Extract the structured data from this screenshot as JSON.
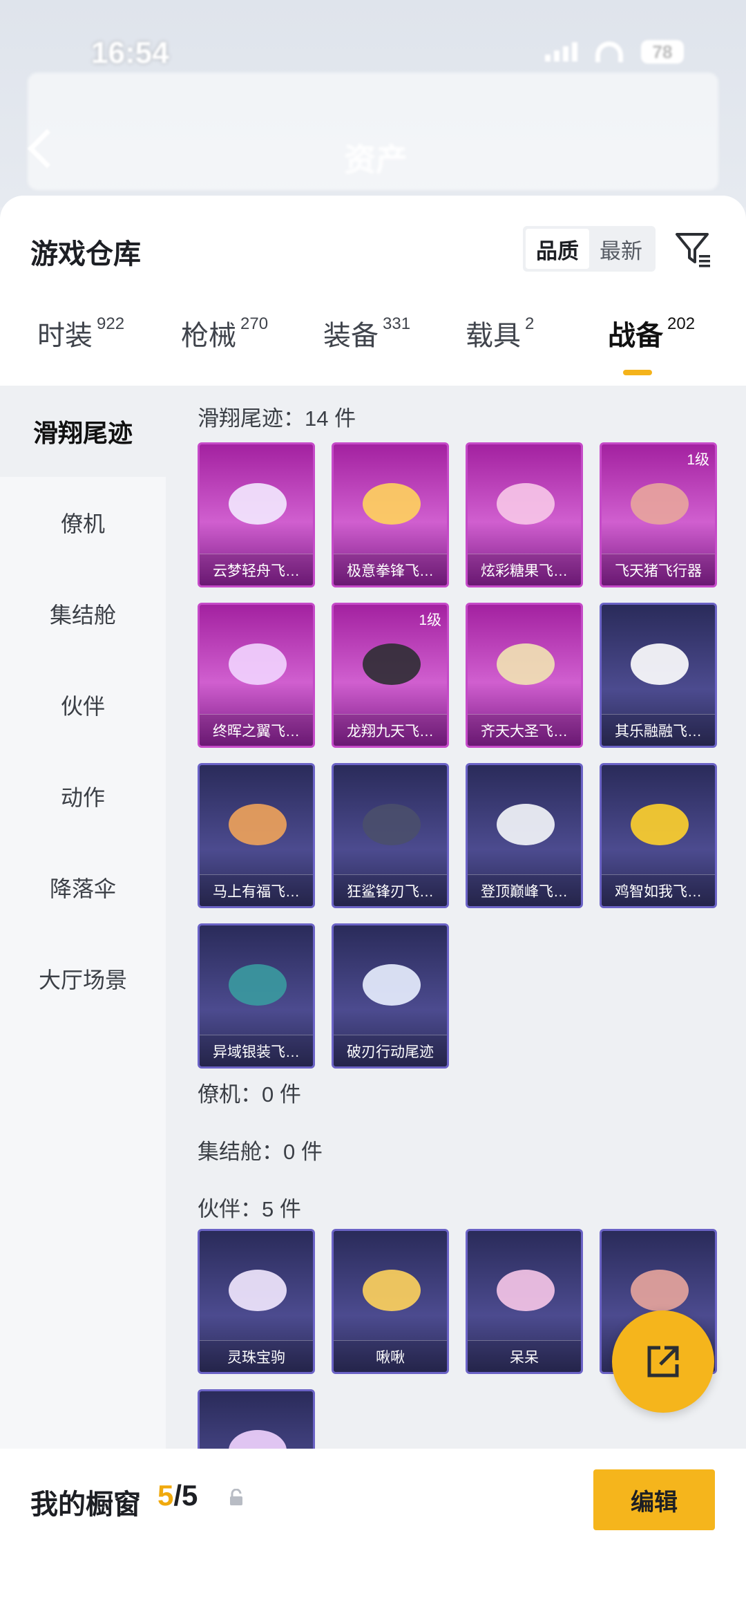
{
  "status": {
    "time": "16:54",
    "battery": "78"
  },
  "nav": {
    "title": "资产"
  },
  "sheet": {
    "title": "游戏仓库"
  },
  "sort": {
    "options": [
      "品质",
      "最新"
    ],
    "active": "品质"
  },
  "tabs": [
    {
      "label": "时装",
      "count": "922"
    },
    {
      "label": "枪械",
      "count": "270"
    },
    {
      "label": "装备",
      "count": "331"
    },
    {
      "label": "载具",
      "count": "2"
    },
    {
      "label": "战备",
      "count": "202"
    }
  ],
  "active_tab": "战备",
  "sidebar": {
    "items": [
      "滑翔尾迹",
      "僚机",
      "集结舱",
      "伙伴",
      "动作",
      "降落伞",
      "大厅场景"
    ],
    "active": "滑翔尾迹"
  },
  "sections": {
    "glide": {
      "title": "滑翔尾迹：14 件",
      "items": [
        {
          "name": "云梦轻舟飞…",
          "level": "",
          "rarity": "pink"
        },
        {
          "name": "极意拳锋飞…",
          "level": "",
          "rarity": "pink"
        },
        {
          "name": "炫彩糖果飞…",
          "level": "",
          "rarity": "pink"
        },
        {
          "name": "飞天猪飞行器",
          "level": "1级",
          "rarity": "pink"
        },
        {
          "name": "终晖之翼飞…",
          "level": "",
          "rarity": "pink"
        },
        {
          "name": "龙翔九天飞…",
          "level": "1级",
          "rarity": "pink"
        },
        {
          "name": "齐天大圣飞…",
          "level": "",
          "rarity": "pink"
        },
        {
          "name": "其乐融融飞…",
          "level": "",
          "rarity": "blue"
        },
        {
          "name": "马上有福飞…",
          "level": "",
          "rarity": "blue"
        },
        {
          "name": "狂鲨锋刃飞…",
          "level": "",
          "rarity": "blue"
        },
        {
          "name": "登顶巅峰飞…",
          "level": "",
          "rarity": "blue"
        },
        {
          "name": "鸡智如我飞…",
          "level": "",
          "rarity": "blue"
        },
        {
          "name": "异域银装飞…",
          "level": "",
          "rarity": "blue"
        },
        {
          "name": "破刃行动尾迹",
          "level": "",
          "rarity": "blue"
        }
      ]
    },
    "wingman": {
      "title": "僚机：0 件"
    },
    "capsule": {
      "title": "集结舱：0 件"
    },
    "partner": {
      "title": "伙伴：5 件",
      "items": [
        {
          "name": "灵珠宝驹",
          "rarity": "blue"
        },
        {
          "name": "啾啾",
          "rarity": "blue"
        },
        {
          "name": "呆呆",
          "rarity": "blue"
        },
        {
          "name": "",
          "rarity": "blue"
        },
        {
          "name": "",
          "rarity": "blue"
        }
      ]
    }
  },
  "colors": {
    "accent": "#f5b51c",
    "pink_card": "#c54ac8",
    "blue_card": "#4c4b8f"
  },
  "showcase": {
    "title": "我的橱窗",
    "current": "5",
    "total": "/5",
    "edit_label": "编辑"
  },
  "icons": {
    "back": "back-arrow-icon",
    "filter": "filter-icon",
    "share": "external-link-icon",
    "lock": "lock-icon"
  }
}
